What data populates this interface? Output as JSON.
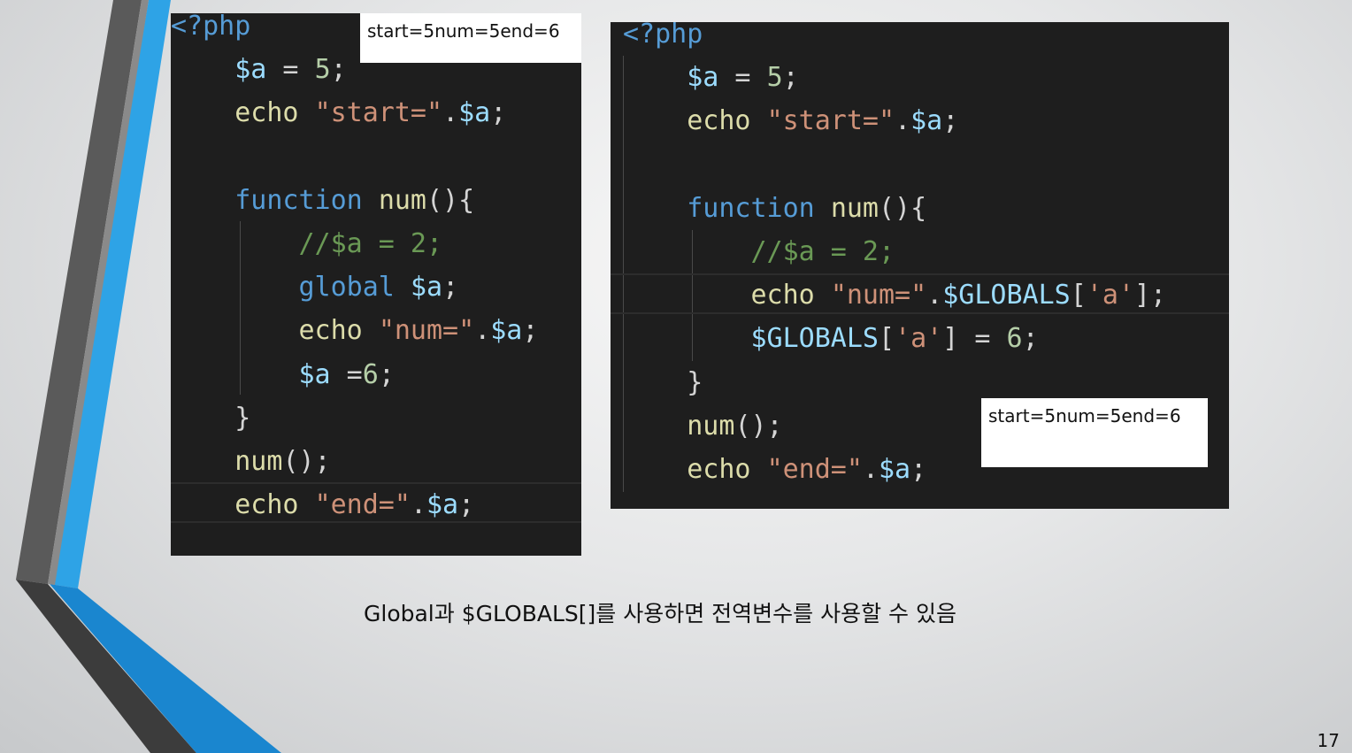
{
  "slide": {
    "caption": "Global과 $GLOBALS[]를 사용하면 전역변수를 사용할 수 있음",
    "page_number": "17",
    "accent_colors": [
      "#2e9fe0",
      "#5a5a5a",
      "#1a8ad4",
      "#3c3c3c"
    ]
  },
  "left_code": {
    "output": "start=5num=5end=6",
    "lines": [
      {
        "indent": "",
        "parts": [
          {
            "t": "tag",
            "s": "<?php"
          }
        ]
      },
      {
        "indent": "    ",
        "parts": [
          {
            "t": "var",
            "s": "$a"
          },
          {
            "t": "op",
            "s": " = "
          },
          {
            "t": "num",
            "s": "5"
          },
          {
            "t": "op",
            "s": ";"
          }
        ]
      },
      {
        "indent": "    ",
        "parts": [
          {
            "t": "fn",
            "s": "echo"
          },
          {
            "t": "op",
            "s": " "
          },
          {
            "t": "str",
            "s": "\"start=\""
          },
          {
            "t": "op",
            "s": "."
          },
          {
            "t": "var",
            "s": "$a"
          },
          {
            "t": "op",
            "s": ";"
          }
        ]
      },
      {
        "indent": "",
        "parts": []
      },
      {
        "indent": "    ",
        "parts": [
          {
            "t": "kw",
            "s": "function"
          },
          {
            "t": "op",
            "s": " "
          },
          {
            "t": "fn",
            "s": "num"
          },
          {
            "t": "op",
            "s": "(){"
          }
        ]
      },
      {
        "indent": "        ",
        "parts": [
          {
            "t": "com",
            "s": "//$a = 2;"
          }
        ]
      },
      {
        "indent": "        ",
        "parts": [
          {
            "t": "kw",
            "s": "global"
          },
          {
            "t": "op",
            "s": " "
          },
          {
            "t": "var",
            "s": "$a"
          },
          {
            "t": "op",
            "s": ";"
          }
        ]
      },
      {
        "indent": "        ",
        "parts": [
          {
            "t": "fn",
            "s": "echo"
          },
          {
            "t": "op",
            "s": " "
          },
          {
            "t": "str",
            "s": "\"num=\""
          },
          {
            "t": "op",
            "s": "."
          },
          {
            "t": "var",
            "s": "$a"
          },
          {
            "t": "op",
            "s": ";"
          }
        ]
      },
      {
        "indent": "        ",
        "parts": [
          {
            "t": "var",
            "s": "$a"
          },
          {
            "t": "op",
            "s": " ="
          },
          {
            "t": "num",
            "s": "6"
          },
          {
            "t": "op",
            "s": ";"
          }
        ]
      },
      {
        "indent": "    ",
        "parts": [
          {
            "t": "op",
            "s": "}"
          }
        ]
      },
      {
        "indent": "    ",
        "parts": [
          {
            "t": "fn",
            "s": "num"
          },
          {
            "t": "op",
            "s": "();"
          }
        ]
      },
      {
        "indent": "    ",
        "parts": [
          {
            "t": "fn",
            "s": "echo"
          },
          {
            "t": "op",
            "s": " "
          },
          {
            "t": "str",
            "s": "\"end=\""
          },
          {
            "t": "op",
            "s": "."
          },
          {
            "t": "var",
            "s": "$a"
          },
          {
            "t": "op",
            "s": ";"
          }
        ]
      }
    ]
  },
  "right_code": {
    "output": "start=5num=5end=6",
    "lines": [
      {
        "indent": "",
        "parts": [
          {
            "t": "tag",
            "s": "<?php"
          }
        ]
      },
      {
        "indent": "    ",
        "parts": [
          {
            "t": "var",
            "s": "$a"
          },
          {
            "t": "op",
            "s": " = "
          },
          {
            "t": "num",
            "s": "5"
          },
          {
            "t": "op",
            "s": ";"
          }
        ]
      },
      {
        "indent": "    ",
        "parts": [
          {
            "t": "fn",
            "s": "echo"
          },
          {
            "t": "op",
            "s": " "
          },
          {
            "t": "str",
            "s": "\"start=\""
          },
          {
            "t": "op",
            "s": "."
          },
          {
            "t": "var",
            "s": "$a"
          },
          {
            "t": "op",
            "s": ";"
          }
        ]
      },
      {
        "indent": "",
        "parts": []
      },
      {
        "indent": "    ",
        "parts": [
          {
            "t": "kw",
            "s": "function"
          },
          {
            "t": "op",
            "s": " "
          },
          {
            "t": "fn",
            "s": "num"
          },
          {
            "t": "op",
            "s": "(){"
          }
        ]
      },
      {
        "indent": "        ",
        "parts": [
          {
            "t": "com",
            "s": "//$a = 2;"
          }
        ]
      },
      {
        "indent": "        ",
        "parts": [
          {
            "t": "fn",
            "s": "echo"
          },
          {
            "t": "op",
            "s": " "
          },
          {
            "t": "str",
            "s": "\"num=\""
          },
          {
            "t": "op",
            "s": "."
          },
          {
            "t": "var",
            "s": "$GLOBALS"
          },
          {
            "t": "op",
            "s": "["
          },
          {
            "t": "str",
            "s": "'a'"
          },
          {
            "t": "op",
            "s": "];"
          }
        ]
      },
      {
        "indent": "        ",
        "parts": [
          {
            "t": "var",
            "s": "$GLOBALS"
          },
          {
            "t": "op",
            "s": "["
          },
          {
            "t": "str",
            "s": "'a'"
          },
          {
            "t": "op",
            "s": "] = "
          },
          {
            "t": "num",
            "s": "6"
          },
          {
            "t": "op",
            "s": ";"
          }
        ]
      },
      {
        "indent": "    ",
        "parts": [
          {
            "t": "op",
            "s": "}"
          }
        ]
      },
      {
        "indent": "    ",
        "parts": [
          {
            "t": "fn",
            "s": "num"
          },
          {
            "t": "op",
            "s": "();"
          }
        ]
      },
      {
        "indent": "    ",
        "parts": [
          {
            "t": "fn",
            "s": "echo"
          },
          {
            "t": "op",
            "s": " "
          },
          {
            "t": "str",
            "s": "\"end=\""
          },
          {
            "t": "op",
            "s": "."
          },
          {
            "t": "var",
            "s": "$a"
          },
          {
            "t": "op",
            "s": ";"
          }
        ]
      }
    ]
  }
}
